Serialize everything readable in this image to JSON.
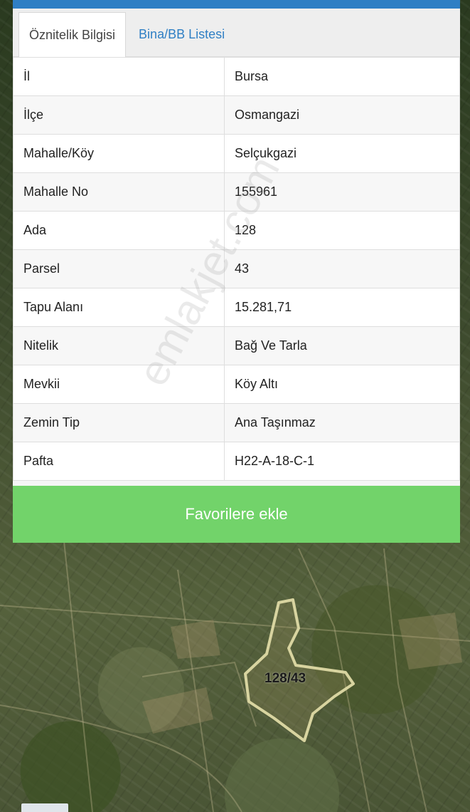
{
  "tabs": [
    {
      "label": "Öznitelik Bilgisi"
    },
    {
      "label": "Bina/BB Listesi"
    }
  ],
  "attributes": [
    {
      "label": "İl",
      "value": "Bursa"
    },
    {
      "label": "İlçe",
      "value": "Osmangazi"
    },
    {
      "label": "Mahalle/Köy",
      "value": "Selçukgazi"
    },
    {
      "label": "Mahalle No",
      "value": "155961"
    },
    {
      "label": "Ada",
      "value": "128"
    },
    {
      "label": "Parsel",
      "value": "43"
    },
    {
      "label": "Tapu Alanı",
      "value": "15.281,71"
    },
    {
      "label": "Nitelik",
      "value": "Bağ Ve Tarla"
    },
    {
      "label": "Mevkii",
      "value": "Köy Altı"
    },
    {
      "label": "Zemin Tip",
      "value": "Ana Taşınmaz"
    },
    {
      "label": "Pafta",
      "value": "H22-A-18-C-1"
    }
  ],
  "favorite_button": {
    "label": "Favorilere ekle"
  },
  "map": {
    "parcel_label": "128/43"
  },
  "watermark": "emlakjet.com",
  "colors": {
    "accent_blue": "#2f7fc4",
    "button_green": "#72d36a",
    "parcel_outline": "#d8d4a0"
  }
}
